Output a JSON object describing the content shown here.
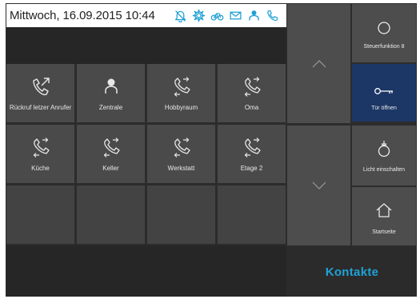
{
  "header": {
    "datetime": "Mittwoch, 16.09.2015 10:44",
    "icon_color": "#1ea0d5",
    "status_icons": [
      "bell-mute-icon",
      "gear-icon",
      "bicycle-icon",
      "mail-icon",
      "person-icon",
      "phone-icon"
    ]
  },
  "tiles": [
    {
      "label": "Rückruf letzer Anrufer",
      "icon": "callback-phone-icon"
    },
    {
      "label": "Zentrale",
      "icon": "person-icon"
    },
    {
      "label": "Hobbyraum",
      "icon": "handset-transfer-icon"
    },
    {
      "label": "Oma",
      "icon": "handset-transfer-icon"
    },
    {
      "label": "Küche",
      "icon": "handset-transfer-icon"
    },
    {
      "label": "Keller",
      "icon": "handset-transfer-icon"
    },
    {
      "label": "Werkstatt",
      "icon": "handset-transfer-icon"
    },
    {
      "label": "Etage 2",
      "icon": "handset-transfer-icon"
    }
  ],
  "scroll": {
    "up_icon": "chevron-up-icon",
    "down_icon": "chevron-down-icon"
  },
  "right_buttons": [
    {
      "label": "Steuerfunktion 8",
      "icon": "circle-icon"
    },
    {
      "label": "Tür öffnen",
      "icon": "key-icon",
      "active": true,
      "active_color": "#1c3766"
    },
    {
      "label": "Licht einschalten",
      "icon": "light-bulb-icon"
    },
    {
      "label": "Startseite",
      "icon": "home-icon"
    }
  ],
  "footer": {
    "contacts_label": "Kontakte",
    "contacts_color": "#1fa2d6"
  }
}
